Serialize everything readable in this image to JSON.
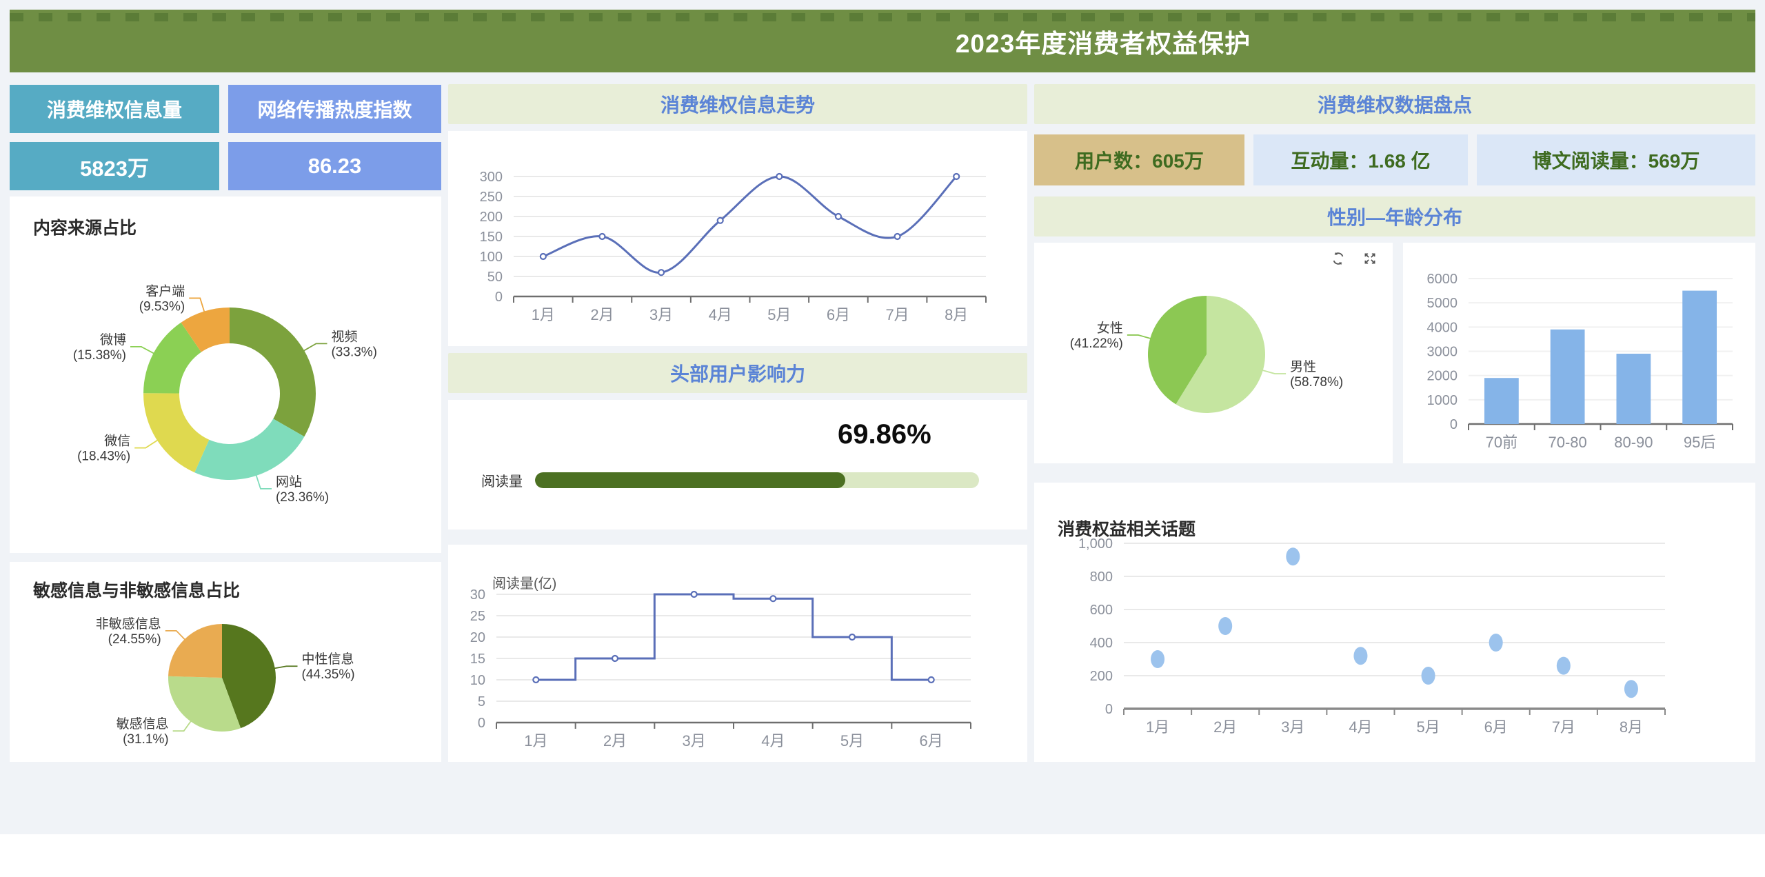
{
  "header": {
    "title": "2023年度消费者权益保护"
  },
  "colors": {
    "header_bg": "#6f8e44",
    "banner_bg": "#e8eed8",
    "banner_text": "#5b84d6",
    "kpi_teal": "#56abc4",
    "kpi_periwinkle": "#7c9de9",
    "kpi_tan": "#d7c08a",
    "kpi_lightblue": "#dbe7f7",
    "kpi_green_text": "#3e6b20",
    "line_stroke": "#5a6fb8",
    "bar_blue": "#85b4e8",
    "scatter_blue": "#9cc3ed",
    "progress_fill": "#4c7022",
    "progress_track": "#dbe8c4"
  },
  "left": {
    "kpis": [
      {
        "label": "消费维权信息量",
        "value": "5823万"
      },
      {
        "label": "网络传播热度指数",
        "value": "86.23"
      }
    ]
  },
  "right": {
    "data_banner": "消费维权数据盘点",
    "kpis": [
      {
        "text": "用户数：605万"
      },
      {
        "text": "互动量：1.68 亿"
      },
      {
        "text": "博文阅读量：569万"
      }
    ],
    "gender_age_banner": "性别—年龄分布",
    "toolbox_icons": [
      "refresh-icon",
      "fullscreen-icon"
    ]
  },
  "chart_data": [
    {
      "id": "trend_line",
      "type": "line",
      "smooth": true,
      "title": "消费维权信息走势",
      "categories": [
        "1月",
        "2月",
        "3月",
        "4月",
        "5月",
        "6月",
        "7月",
        "8月"
      ],
      "values": [
        100,
        150,
        60,
        190,
        300,
        200,
        150,
        300
      ],
      "ylim": [
        0,
        300
      ],
      "yticks": [
        0,
        50,
        100,
        150,
        200,
        250,
        300
      ],
      "color": "#5a6fb8"
    },
    {
      "id": "source_donut",
      "type": "pie",
      "donut": true,
      "title": "内容来源占比",
      "slices": [
        {
          "label": "视频",
          "value": 33.3,
          "pct_label": "(33.3%)",
          "color": "#7ca23d"
        },
        {
          "label": "网站",
          "value": 23.36,
          "pct_label": "(23.36%)",
          "color": "#7fdcbb"
        },
        {
          "label": "微信",
          "value": 18.43,
          "pct_label": "(18.43%)",
          "color": "#dfd94f"
        },
        {
          "label": "微博",
          "value": 15.38,
          "pct_label": "(15.38%)",
          "color": "#8bd054"
        },
        {
          "label": "客户端",
          "value": 9.53,
          "pct_label": "(9.53%)",
          "color": "#eda63f"
        }
      ]
    },
    {
      "id": "sensitivity_pie",
      "type": "pie",
      "donut": false,
      "title": "敏感信息与非敏感信息占比",
      "slices": [
        {
          "label": "中性信息",
          "value": 44.35,
          "pct_label": "(44.35%)",
          "color": "#56771e"
        },
        {
          "label": "敏感信息",
          "value": 31.1,
          "pct_label": "(31.1%)",
          "color": "#b9db8b"
        },
        {
          "label": "非敏感信息",
          "value": 24.55,
          "pct_label": "(24.55%)",
          "color": "#e9ab51"
        }
      ]
    },
    {
      "id": "influence_progress",
      "type": "progress",
      "title": "头部用户影响力",
      "label": "阅读量",
      "percent": 69.86,
      "percent_label": "69.86%"
    },
    {
      "id": "reading_step",
      "type": "line",
      "step": "middle",
      "ylabel": "阅读量(亿)",
      "categories": [
        "1月",
        "2月",
        "3月",
        "4月",
        "5月",
        "6月"
      ],
      "values": [
        10,
        15,
        30,
        29,
        20,
        10
      ],
      "ylim": [
        0,
        30
      ],
      "yticks": [
        0,
        5,
        10,
        15,
        20,
        25,
        30
      ],
      "color": "#5a6fb8"
    },
    {
      "id": "gender_pie",
      "type": "pie",
      "donut": false,
      "slices": [
        {
          "label": "男性",
          "value": 58.78,
          "pct_label": "(58.78%)",
          "color": "#c5e5a0"
        },
        {
          "label": "女性",
          "value": 41.22,
          "pct_label": "(41.22%)",
          "color": "#8cc853"
        }
      ]
    },
    {
      "id": "age_bar",
      "type": "bar",
      "categories": [
        "70前",
        "70-80",
        "80-90",
        "95后"
      ],
      "values": [
        1900,
        3900,
        2900,
        5500
      ],
      "ylim": [
        0,
        6000
      ],
      "yticks": [
        0,
        1000,
        2000,
        3000,
        4000,
        5000,
        6000
      ],
      "color": "#85b4e8"
    },
    {
      "id": "topics_scatter",
      "type": "scatter",
      "title": "消费权益相关话题",
      "categories": [
        "1月",
        "2月",
        "3月",
        "4月",
        "5月",
        "6月",
        "7月",
        "8月"
      ],
      "values": [
        300,
        500,
        920,
        320,
        200,
        400,
        260,
        120
      ],
      "ylim": [
        0,
        1000
      ],
      "yticks": [
        0,
        200,
        400,
        600,
        800,
        1000
      ],
      "ytick_labels": [
        "0",
        "200",
        "400",
        "600",
        "800",
        "1,000"
      ],
      "color": "#9cc3ed"
    }
  ]
}
